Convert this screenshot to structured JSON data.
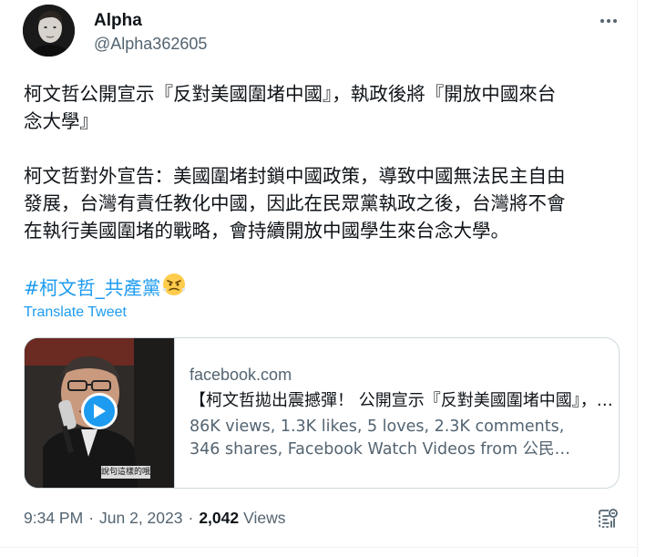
{
  "author": {
    "name": "Alpha",
    "handle": "@Alpha362605",
    "avatar_icon": "avatar-photo"
  },
  "tweet": {
    "paragraph1": [
      "柯文哲公開宣示『反對美國圍堵中國』，執政後將『開放中國來台",
      "念大學』"
    ],
    "paragraph2": [
      "柯文哲對外宣告：美國圍堵封鎖中國政策，導致中國無法民主自由",
      "發展，台灣有責任教化中國，因此在民眾黨執政之後，台灣將不會",
      "在執行美國圍堵的戰略，會持續開放中國學生來台念大學。"
    ],
    "hashtag": "#柯文哲_共產黨",
    "emoji": "😤",
    "translate_label": "Translate Tweet"
  },
  "card": {
    "domain": "facebook.com",
    "title": "【柯文哲拋出震撼彈！ 公開宣示『反對美國圍堵中國』，執政後將『開放中國來台念大學』",
    "description": [
      "86K views, 1.3K likes, 5 loves, 2.3K comments,",
      "346 shares, Facebook Watch Videos from 公民…"
    ],
    "thumbnail_caption": "說句這樣的哦",
    "play_icon": "play-icon"
  },
  "meta": {
    "time": "9:34 PM",
    "separator": "·",
    "date": "Jun 2, 2023",
    "views_count": "2,042",
    "views_label": "Views"
  },
  "colors": {
    "accent": "#1d9bf0",
    "text_primary": "#0f1419",
    "text_secondary": "#536471",
    "border": "#cfd9de"
  }
}
